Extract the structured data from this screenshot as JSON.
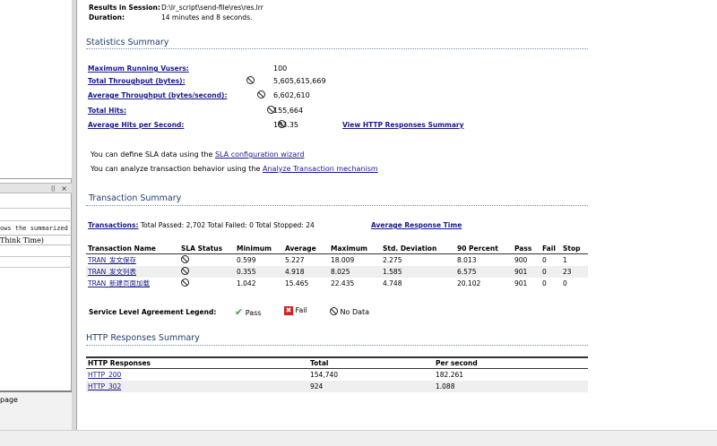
{
  "header": {
    "results_label": "Results in Session:",
    "results_value": "D:\\lr_script\\send-file\\res\\res.lrr",
    "duration_label": "Duration:",
    "duration_value": "14 minutes and 8 seconds."
  },
  "left_panel": {
    "dock_buttons": "⌷ ×",
    "desc_text": "ows the summarized",
    "desc_input": "Think Time)",
    "bottom_tab": "page"
  },
  "statistics": {
    "title": "Statistics Summary",
    "rows": [
      {
        "label": "Maximum Running Vusers:",
        "value": "100",
        "has_icon": false
      },
      {
        "label": "Total Throughput (bytes):",
        "value": "5,605,615,669",
        "has_icon": true
      },
      {
        "label": "Average Throughput (bytes/second):",
        "value": "6,602,610",
        "has_icon": true
      },
      {
        "label": "Total Hits:",
        "value": "155,664",
        "has_icon": true
      },
      {
        "label": "Average Hits per Second:",
        "value": "183.35",
        "has_icon": true
      }
    ],
    "http_link": "View HTTP Responses Summary"
  },
  "sla": {
    "line1_prefix": "You can define SLA data using the ",
    "line1_link": "SLA configuration wizard",
    "line2_prefix": "You can analyze transaction behavior using the ",
    "line2_link": "Analyze Transaction mechanism"
  },
  "transactions": {
    "title": "Transaction Summary",
    "summary_link": "Transactions:",
    "summary_text": " Total Passed: 2,702 Total Failed: 0 Total Stopped: 24",
    "avg_link": "Average Response Time",
    "columns": [
      "Transaction Name",
      "SLA Status",
      "Minimum",
      "Average",
      "Maximum",
      "Std. Deviation",
      "90 Percent",
      "Pass",
      "Fail",
      "Stop"
    ],
    "rows": [
      {
        "name": "TRAN_发文保存",
        "min": "0.599",
        "avg": "5.227",
        "max": "18.009",
        "std": "2.275",
        "p90": "8.013",
        "pass": "900",
        "fail": "0",
        "stop": "1"
      },
      {
        "name": "TRAN_发文列表",
        "min": "0.355",
        "avg": "4.918",
        "max": "8.025",
        "std": "1.585",
        "p90": "6.575",
        "pass": "901",
        "fail": "0",
        "stop": "23"
      },
      {
        "name": "TRAN_新建页面加载",
        "min": "1.042",
        "avg": "15.465",
        "max": "22.435",
        "std": "4.748",
        "p90": "20.102",
        "pass": "901",
        "fail": "0",
        "stop": "0"
      }
    ]
  },
  "legend": {
    "title": "Service Level Agreement Legend:",
    "pass": "Pass",
    "fail": "Fail",
    "nodata": "No Data",
    "pass_color": "#3aa63a",
    "fail_color": "#d42020"
  },
  "http": {
    "title": "HTTP Responses Summary",
    "columns": [
      "HTTP Responses",
      "Total",
      "Per second"
    ],
    "rows": [
      {
        "code": "HTTP_200",
        "total": "154,740",
        "per_second": "182.261"
      },
      {
        "code": "HTTP_302",
        "total": "924",
        "per_second": "1.088"
      }
    ]
  }
}
